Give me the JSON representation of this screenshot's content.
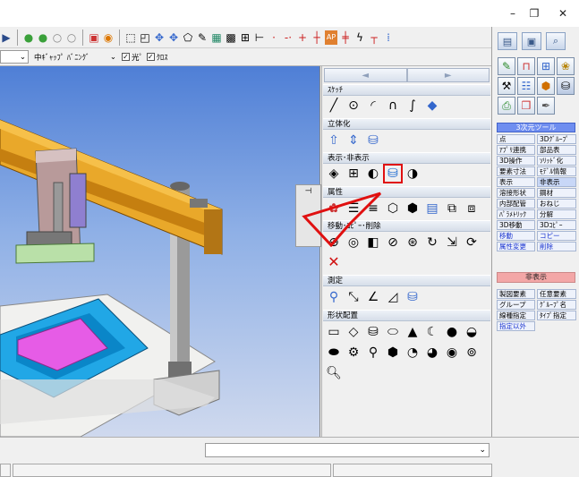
{
  "window": {
    "min_glyph": "–",
    "max_glyph": "❐",
    "close_glyph": "✕"
  },
  "optbar": {
    "combo1_value": "",
    "combo2_value": "中ｷﾞｬｯﾌﾟ ﾊﾞﾆﾝｸﾞ",
    "check1_label": "光ﾟ",
    "check2_label": "ｸﾛｽ",
    "check1_checked": "✓",
    "check2_checked": "✓"
  },
  "nav": {
    "left": "◄",
    "right": "►"
  },
  "pin": {
    "label": "⊣"
  },
  "sections": {
    "sketch": "ｽｹｯﾁ",
    "solid": "立体化",
    "show_hide": "表示･非表示",
    "attr": "属性",
    "move_copy": "移動･ｺﾋﾟｰ･削除",
    "measure": "測定",
    "shape": "形状配置"
  },
  "right_panel": {
    "header": "3次元ツール",
    "tools": [
      [
        "点",
        "3Dｸﾞﾙｰﾌﾟ"
      ],
      [
        "ｱﾌﾟﾘ連携",
        "部品表"
      ],
      [
        "3D操作",
        "ｿﾘｯﾄﾞ化"
      ],
      [
        "要素寸法",
        "ﾓﾃﾞﾙ情報"
      ],
      [
        "表示",
        "非表示"
      ],
      [
        "溶接形状",
        "鋼材"
      ],
      [
        "内部配管",
        "おねじ"
      ],
      [
        "ﾊﾟﾗﾒﾄﾘｯｸ",
        "分解"
      ],
      [
        "3D移動",
        "3Dｺﾋﾟｰ"
      ],
      [
        "移動",
        "コピー"
      ],
      [
        "属性変更",
        "削除"
      ]
    ],
    "hide_btn": "非表示",
    "sub_tools": [
      [
        "製図要素",
        "任意要素"
      ],
      [
        "グループ",
        "ｸﾞﾙｰﾌﾟ名"
      ],
      [
        "線種指定",
        "ﾀｲﾌﾟ指定"
      ],
      [
        "指定以外",
        ""
      ]
    ]
  },
  "bottom": {
    "combo_arrow": "⌄"
  }
}
